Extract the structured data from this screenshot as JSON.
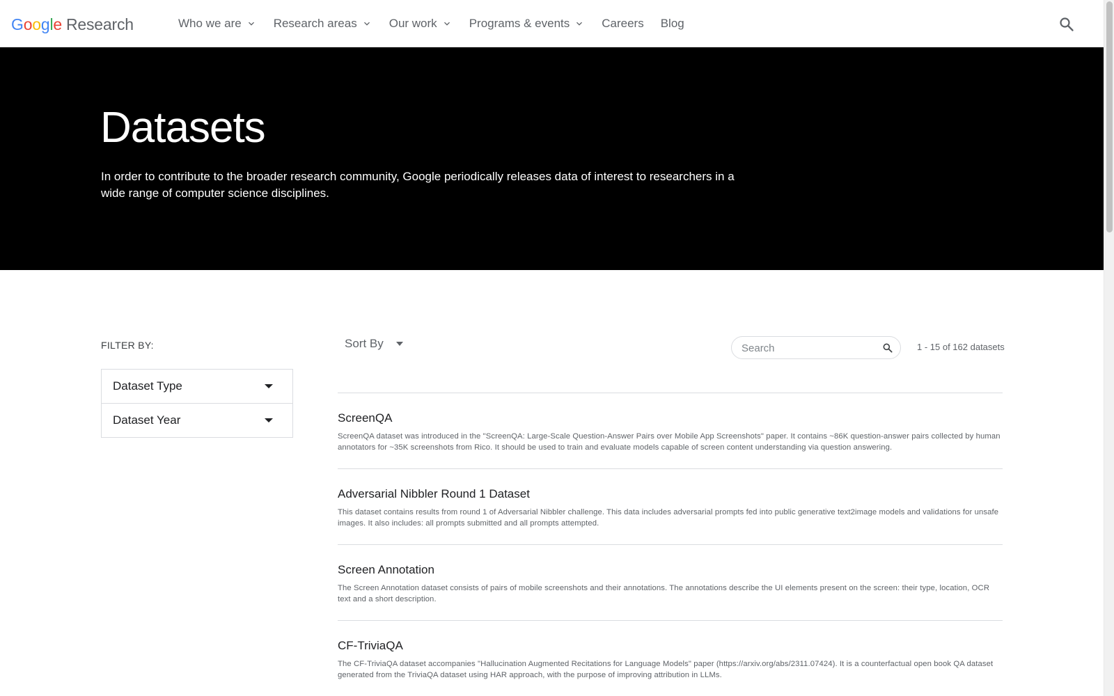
{
  "header": {
    "logo_letters": [
      "G",
      "o",
      "o",
      "g",
      "l",
      "e"
    ],
    "logo_research": "Research",
    "nav": [
      {
        "label": "Who we are",
        "has_menu": true
      },
      {
        "label": "Research areas",
        "has_menu": true
      },
      {
        "label": "Our work",
        "has_menu": true
      },
      {
        "label": "Programs & events",
        "has_menu": true
      },
      {
        "label": "Careers",
        "has_menu": false
      },
      {
        "label": "Blog",
        "has_menu": false
      }
    ],
    "search_icon": "search-icon"
  },
  "hero": {
    "title": "Datasets",
    "description": "In order to contribute to the broader research community, Google periodically releases data of interest to researchers in a wide range of computer science disciplines."
  },
  "filters": {
    "label": "FILTER BY:",
    "items": [
      {
        "label": "Dataset Type"
      },
      {
        "label": "Dataset Year"
      }
    ]
  },
  "toolbar": {
    "sort_label": "Sort By",
    "search_placeholder": "Search",
    "result_count": "1 - 15 of 162 datasets"
  },
  "datasets": [
    {
      "title": "ScreenQA",
      "description": "ScreenQA dataset was introduced in the \"ScreenQA: Large-Scale Question-Answer Pairs over Mobile App Screenshots\" paper. It contains ~86K question-answer pairs collected by human annotators for ~35K screenshots from Rico. It should be used to train and evaluate models capable of screen content understanding via question answering."
    },
    {
      "title": "Adversarial Nibbler Round 1 Dataset",
      "description": "This dataset contains results from round 1 of Adversarial Nibbler challenge. This data includes adversarial prompts fed into public generative text2image models and validations for unsafe images. It also includes: all prompts submitted and all prompts attempted."
    },
    {
      "title": "Screen Annotation",
      "description": "The Screen Annotation dataset consists of pairs of mobile screenshots and their annotations. The annotations describe the UI elements present on the screen: their type, location, OCR text and a short description."
    },
    {
      "title": "CF-TriviaQA",
      "description": "The CF-TriviaQA dataset accompanies \"Hallucination Augmented Recitations for Language Models\" paper (https://arxiv.org/abs/2311.07424). It is a counterfactual open book QA dataset generated from the TriviaQA dataset using HAR approach, with the purpose of improving attribution in LLMs."
    }
  ]
}
